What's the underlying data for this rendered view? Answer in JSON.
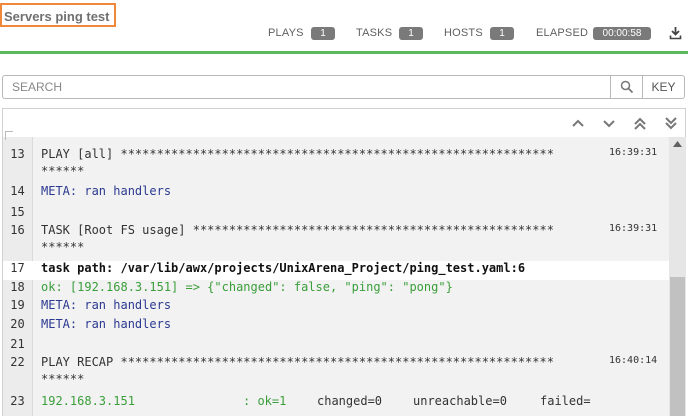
{
  "job": {
    "title": "Servers ping test"
  },
  "stats": {
    "plays_label": "PLAYS",
    "plays_value": "1",
    "tasks_label": "TASKS",
    "tasks_value": "1",
    "hosts_label": "HOSTS",
    "hosts_value": "1",
    "elapsed_label": "ELAPSED",
    "elapsed_value": "00:00:58"
  },
  "search": {
    "placeholder": "SEARCH",
    "key_label": "KEY"
  },
  "toolbar": {
    "icons": [
      "chevron-up-icon",
      "chevron-down-icon",
      "double-chevron-up-icon",
      "double-chevron-down-icon"
    ]
  },
  "colors": {
    "accent_green": "#5cb85c",
    "highlight_orange": "#f0883c",
    "meta_text": "#2b3990",
    "ok_text": "#3a9e3a"
  },
  "output": {
    "lines": [
      {
        "num": "13",
        "text": "PLAY [all] ************************************************************",
        "time": "16:39:31"
      },
      {
        "num": "",
        "text": "******",
        "time": ""
      },
      {
        "num": "14",
        "text": "META: ran handlers",
        "time": ""
      },
      {
        "num": "15",
        "text": "",
        "time": ""
      },
      {
        "num": "16",
        "text": "TASK [Root FS usage] **************************************************",
        "time": "16:39:31"
      },
      {
        "num": "",
        "text": "******",
        "time": ""
      },
      {
        "num": "17",
        "text": "task path: /var/lib/awx/projects/UnixArena_Project/ping_test.yaml:6",
        "time": ""
      },
      {
        "num": "18",
        "text": "ok: [192.168.3.151] => {\"changed\": false, \"ping\": \"pong\"}",
        "time": ""
      },
      {
        "num": "19",
        "text": "META: ran handlers",
        "time": ""
      },
      {
        "num": "20",
        "text": "META: ran handlers",
        "time": ""
      },
      {
        "num": "21",
        "text": "",
        "time": ""
      },
      {
        "num": "22",
        "text": "PLAY RECAP ************************************************************",
        "time": "16:40:14"
      },
      {
        "num": "",
        "text": "******",
        "time": ""
      },
      {
        "num": "23",
        "text": "192.168.3.151",
        "time": ""
      }
    ],
    "recap": {
      "ok": ": ok=1",
      "changed": "changed=0",
      "unreachable": "unreachable=0",
      "failed": "failed="
    }
  }
}
